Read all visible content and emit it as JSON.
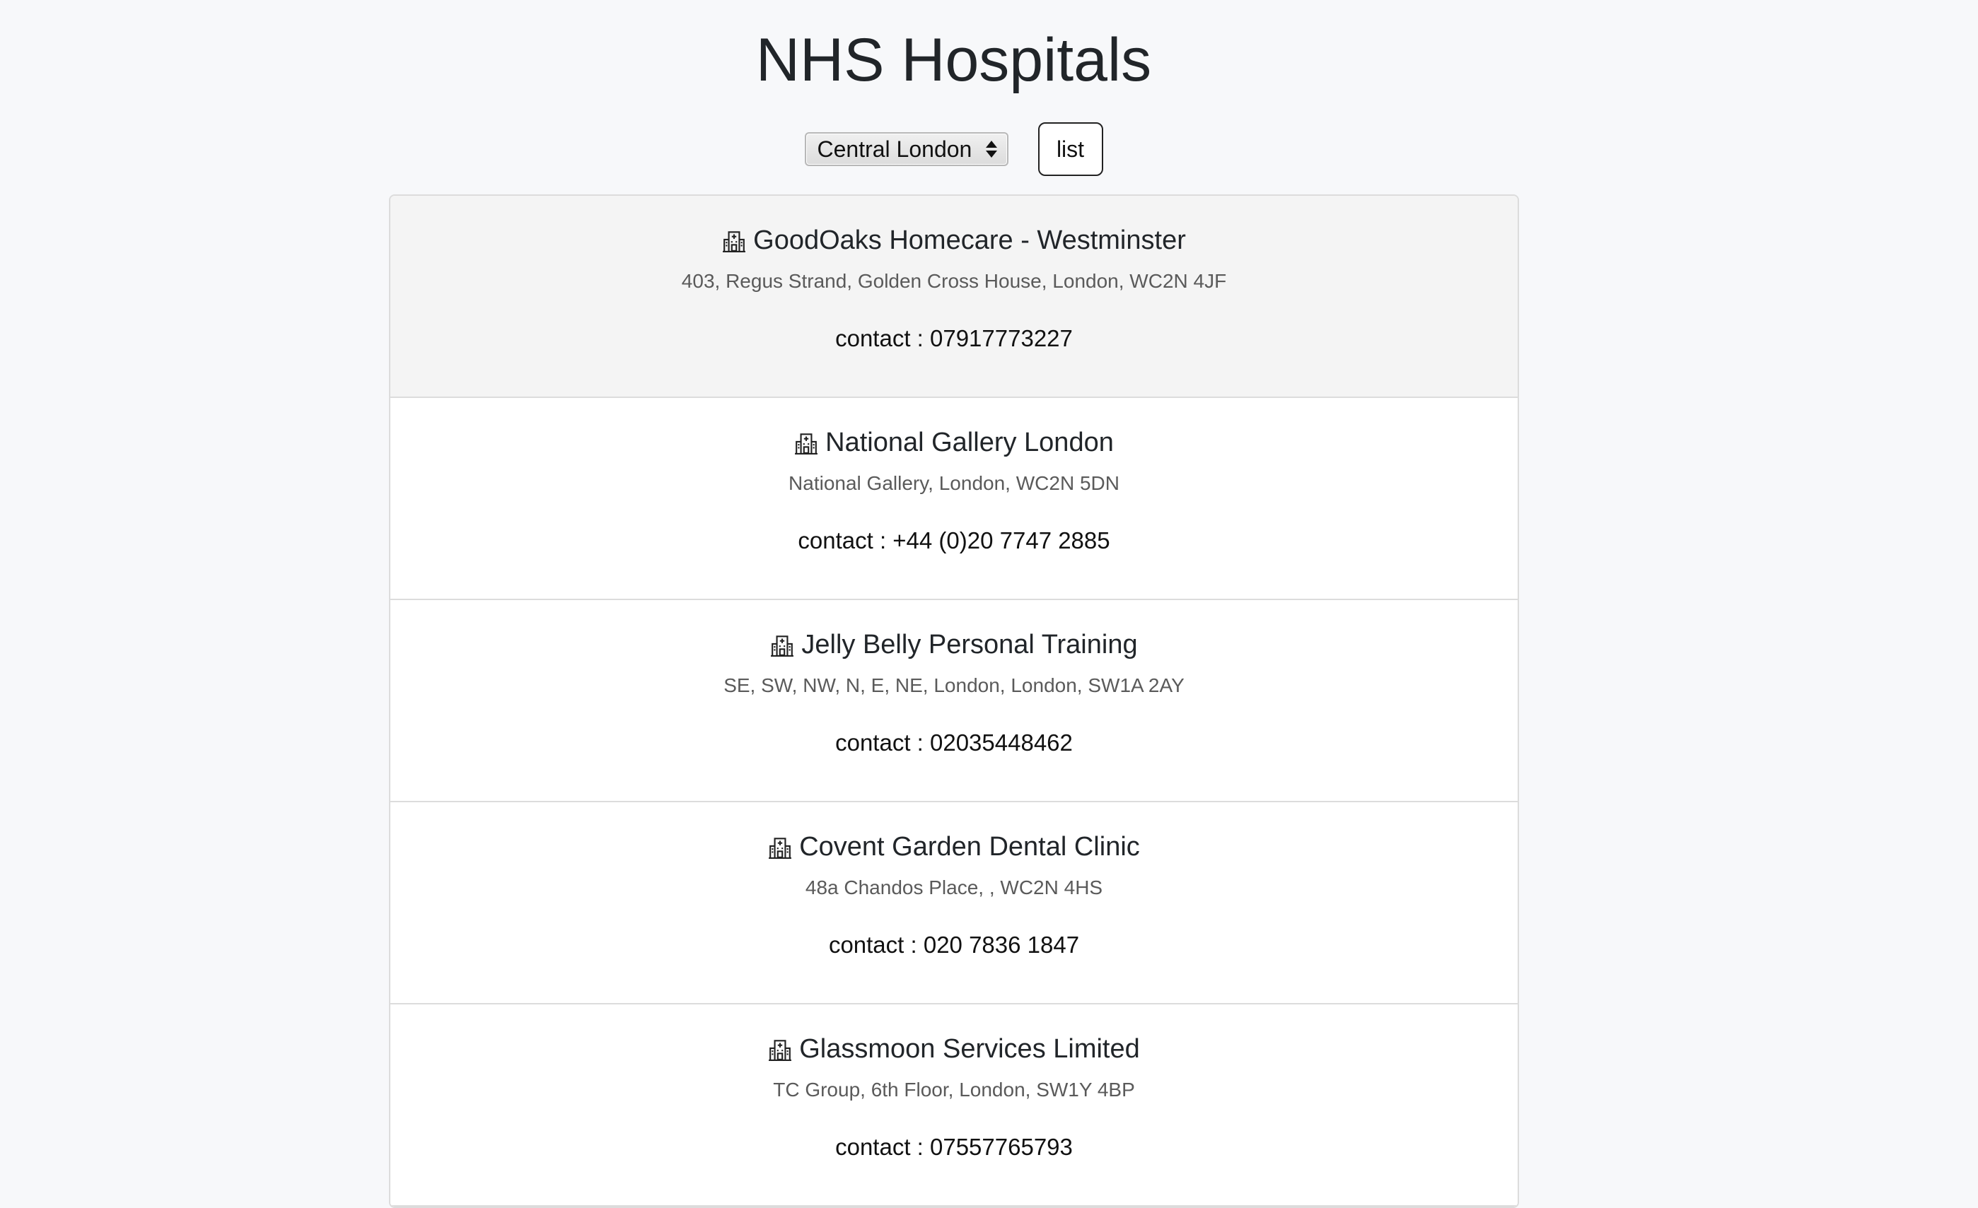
{
  "page": {
    "title": "NHS Hospitals"
  },
  "controls": {
    "region_selected": "Central London",
    "list_button_label": "list"
  },
  "results": [
    {
      "name": "GoodOaks Homecare - Westminster",
      "address": "403, Regus Strand, Golden Cross House, London, WC2N 4JF",
      "contact": "contact : 07917773227",
      "icon": "hospital-icon"
    },
    {
      "name": "National Gallery London",
      "address": "National Gallery, London, WC2N 5DN",
      "contact": "contact : +44 (0)20 7747 2885",
      "icon": "hospital-icon"
    },
    {
      "name": "Jelly Belly Personal Training",
      "address": "SE, SW, NW, N, E, NE, London, London, SW1A 2AY",
      "contact": "contact : 02035448462",
      "icon": "hospital-icon"
    },
    {
      "name": "Covent Garden Dental Clinic",
      "address": "48a Chandos Place, , WC2N 4HS",
      "contact": "contact : 020 7836 1847",
      "icon": "hospital-icon"
    },
    {
      "name": "Glassmoon Services Limited",
      "address": "TC Group, 6th Floor, London, SW1Y 4BP",
      "contact": "contact : 07557765793",
      "icon": "hospital-icon"
    }
  ]
}
